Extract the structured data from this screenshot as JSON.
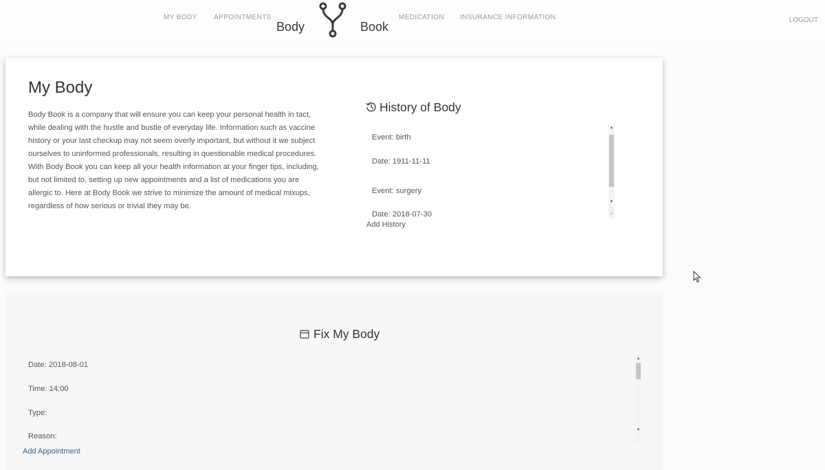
{
  "nav": {
    "left_links": [
      "MY BODY",
      "APPOINTMENTS"
    ],
    "brand_left": "Body",
    "brand_right": "Book",
    "right_links": [
      "MEDICATION",
      "INSURANCE INFORMATION"
    ],
    "logout": "LOGOUT",
    "logo_icon": "fork-logo-icon"
  },
  "about": {
    "title": "My Body",
    "text": "Body Book is a company that will ensure you can keep your personal health in tact, while dealing with the hustle and bustle of everyday life. Information such as vaccine history or your last checkup may not seem overly important, but without it we subject ourselves to uninformed professionals, resulting in questionable medical procedures. With Body Book you can keep all your health information at your finger tips, including, but not limited to, setting up new appointments and a list of medications you are allergic to. Here at Body Book we strive to minimize the amount of medical mixups, regardless of how serious or trivial they may be."
  },
  "history": {
    "heading": "History of Body",
    "icon": "history-icon",
    "items": [
      "Event: birth",
      "Date: 1911-11-11",
      "Event: surgery",
      "Date: 2018-07-30"
    ],
    "add_label": "Add History"
  },
  "fix": {
    "heading": "Fix My Body",
    "icon": "calendar-icon",
    "items": [
      "Date: 2018-08-01",
      "Time: 14:00",
      "Type:",
      "Reason:"
    ],
    "add_label": "Add Appointment"
  },
  "colors": {
    "page_bg": "#fbfbfc",
    "card_bg": "#ffffff",
    "section_bg": "#f7f7f9",
    "link_blue": "#3d5a8a"
  }
}
